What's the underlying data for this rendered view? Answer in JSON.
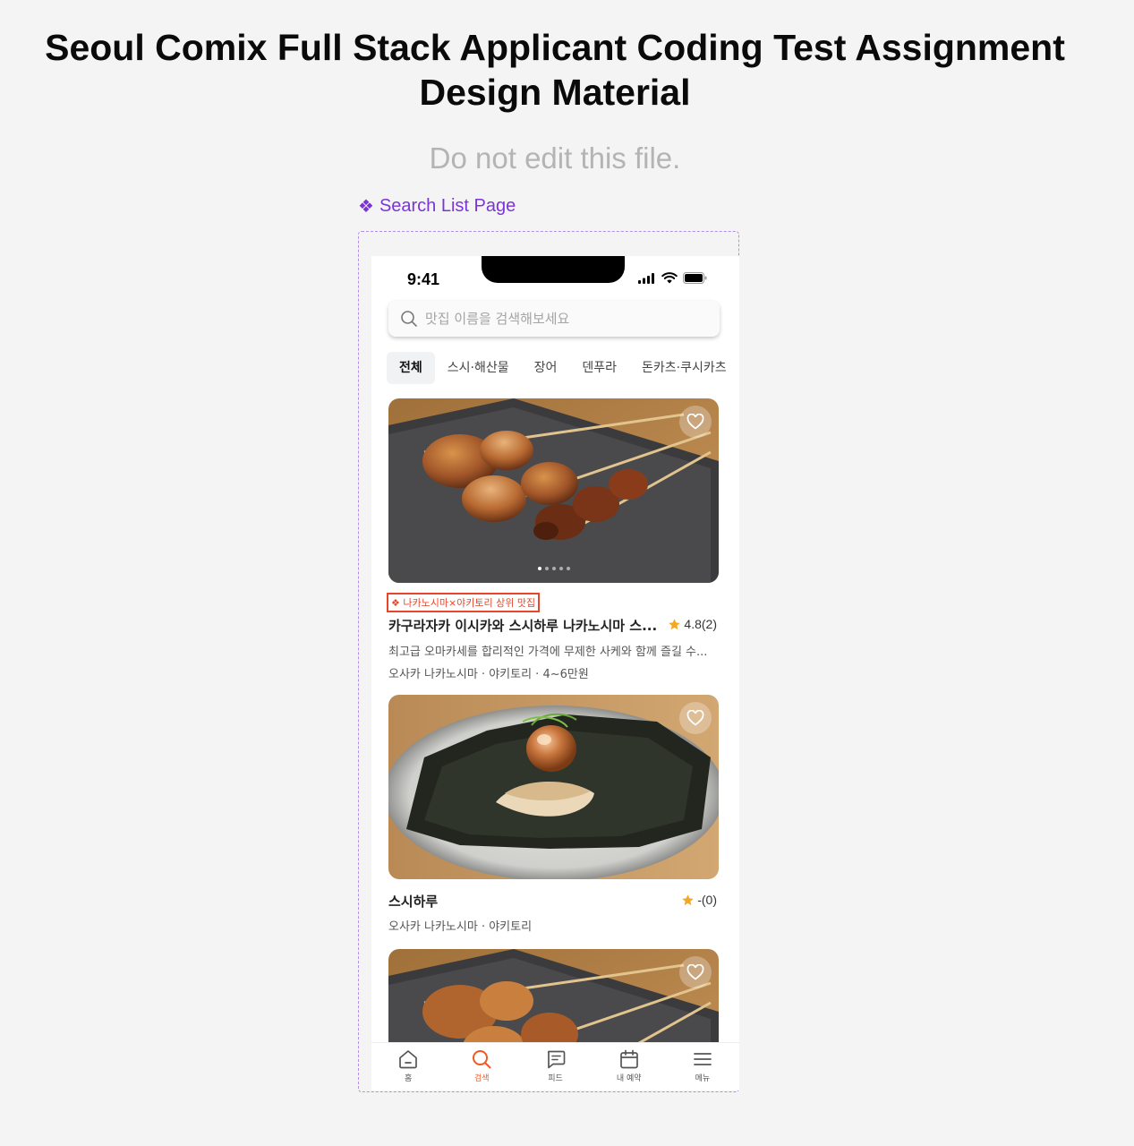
{
  "doc": {
    "title_line1": "Seoul Comix Full Stack Applicant Coding Test Assignment",
    "title_line2": "Design Material",
    "subtitle": "Do not edit this file.",
    "frame_label": "Search List Page",
    "frame_icon": "component-diamond-icon"
  },
  "status_bar": {
    "time": "9:41"
  },
  "search": {
    "placeholder": "맛집 이름을 검색해보세요",
    "value": ""
  },
  "categories": [
    {
      "label": "전체",
      "active": true
    },
    {
      "label": "스시·해산물",
      "active": false
    },
    {
      "label": "장어",
      "active": false
    },
    {
      "label": "덴푸라",
      "active": false
    },
    {
      "label": "돈카츠·쿠시카츠",
      "active": false
    }
  ],
  "restaurants": [
    {
      "image": "yakitori-skewers-photo",
      "badge": "❖ 나카노시마×야키토리 상위 맛집",
      "name": "카구라자카 이시카와 스시하루 나카노시마 스...",
      "rating": "4.8(2)",
      "description": "최고급 오마카세를 합리적인 가격에 무제한 사케와 함께 즐길 수...",
      "meta": "오사카 나카노시마 · 야키토리 · 4~6만원",
      "favorited": false
    },
    {
      "image": "seaweed-dish-photo",
      "name": "스시하루",
      "rating": "-(0)",
      "meta": "오사카 나카노시마 · 야키토리",
      "favorited": false
    },
    {
      "image": "yakitori-skewers-photo",
      "favorited": false
    }
  ],
  "tabs": [
    {
      "label": "홈",
      "icon": "home-icon",
      "active": false
    },
    {
      "label": "검색",
      "icon": "search-icon",
      "active": true
    },
    {
      "label": "피드",
      "icon": "feed-icon",
      "active": false
    },
    {
      "label": "내 예약",
      "icon": "calendar-icon",
      "active": false
    },
    {
      "label": "메뉴",
      "icon": "menu-icon",
      "active": false
    }
  ],
  "colors": {
    "accent": "#ee5a24",
    "badge": "#e8462a",
    "star": "#f5a623",
    "frame": "#7b35d6"
  }
}
